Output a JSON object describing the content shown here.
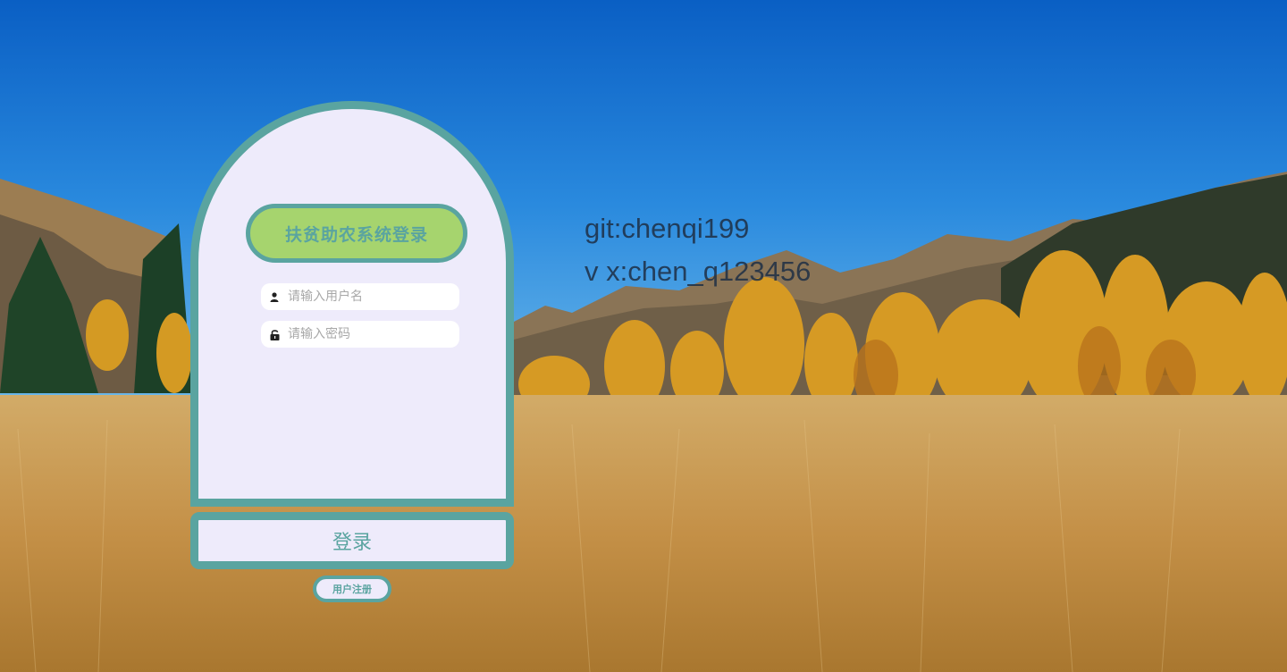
{
  "login": {
    "title": "扶贫助农系统登录",
    "username_placeholder": "请输入用户名",
    "password_placeholder": "请输入密码",
    "submit_label": "登录",
    "register_label": "用户注册",
    "user_icon": "user-icon",
    "lock_icon": "lock-icon"
  },
  "contact": {
    "line1": "git:chenqi199",
    "line2": "v x:chen_q123456"
  },
  "colors": {
    "accent": "#5aa4a0",
    "title_fill": "#a6d46e",
    "card_bg": "#eeebfb"
  }
}
